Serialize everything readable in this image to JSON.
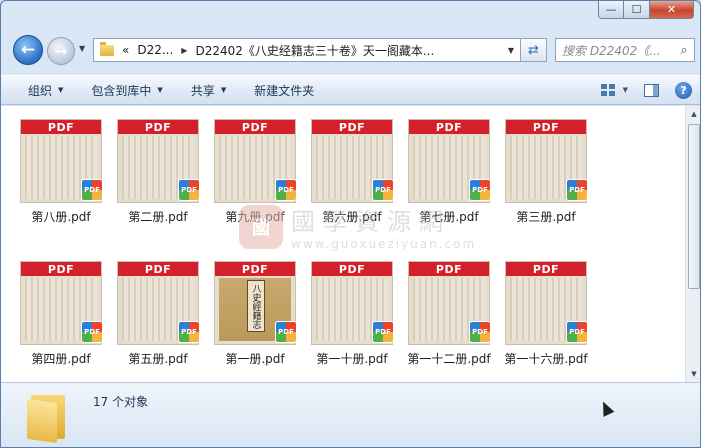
{
  "window": {
    "caption_min": "—",
    "caption_max": "☐",
    "caption_close": "✕"
  },
  "nav": {
    "back_glyph": "←",
    "fwd_glyph": "→",
    "address_prefix": "«",
    "address_parts": [
      "D22...",
      "D22402《八史经籍志三十卷》天一阁藏本..."
    ],
    "search_placeholder": "搜索 D22402《..."
  },
  "toolbar": {
    "organize": "组织",
    "include_library": "包含到库中",
    "share": "共享",
    "new_folder": "新建文件夹"
  },
  "files": [
    {
      "name": "第八册.pdf",
      "cover": false
    },
    {
      "name": "第二册.pdf",
      "cover": false
    },
    {
      "name": "第九册.pdf",
      "cover": false
    },
    {
      "name": "第六册.pdf",
      "cover": false
    },
    {
      "name": "第七册.pdf",
      "cover": false
    },
    {
      "name": "第三册.pdf",
      "cover": false
    },
    {
      "name": "第四册.pdf",
      "cover": false
    },
    {
      "name": "第五册.pdf",
      "cover": false
    },
    {
      "name": "第一册.pdf",
      "cover": true
    },
    {
      "name": "第一十册.pdf",
      "cover": false
    },
    {
      "name": "第一十二册.pdf",
      "cover": false
    },
    {
      "name": "第一十六册.pdf",
      "cover": false
    }
  ],
  "thumb_band": "PDF",
  "thumb_badge": "PDF",
  "cover_title": "八史經籍志",
  "watermark": {
    "seal": "國",
    "cn": "國學資源網",
    "url": "www.guoxueziyuan.com"
  },
  "details": {
    "count": "17 个对象"
  },
  "colors": {
    "pdf_red": "#d4202a",
    "accent": "#2a6fc4"
  }
}
